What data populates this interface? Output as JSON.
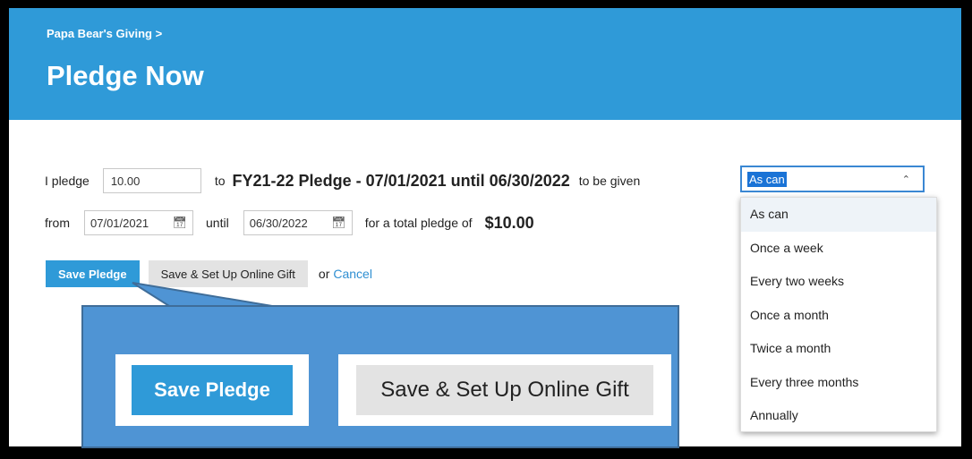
{
  "header": {
    "breadcrumb": "Papa Bear's Giving >",
    "title": "Pledge Now"
  },
  "form": {
    "i_pledge_label": "I pledge",
    "amount_value": "10.00",
    "to_label": "to",
    "fund_name": "FY21-22 Pledge - 07/01/2021 until 06/30/2022",
    "to_be_given_label": "to be given",
    "frequency_selected": "As can",
    "from_label": "from",
    "start_date": "07/01/2021",
    "until_label": "until",
    "end_date": "06/30/2022",
    "total_label": "for a total pledge of",
    "total_value": "$10.00"
  },
  "frequency_options": [
    "As can",
    "Once a week",
    "Every two weeks",
    "Once a month",
    "Twice a month",
    "Every three months",
    "Annually"
  ],
  "actions": {
    "save_pledge": "Save Pledge",
    "save_setup_gift": "Save & Set Up Online Gift",
    "or_label": "or",
    "cancel": "Cancel"
  },
  "callout": {
    "save_pledge": "Save Pledge",
    "save_setup_gift": "Save & Set Up Online Gift"
  },
  "colors": {
    "brand_blue": "#2f9ad8",
    "callout_blue": "#4f94d4",
    "link_blue": "#2f8fd2"
  },
  "icons": {
    "date": "calendar-icon",
    "select": "chevron-up-icon"
  }
}
